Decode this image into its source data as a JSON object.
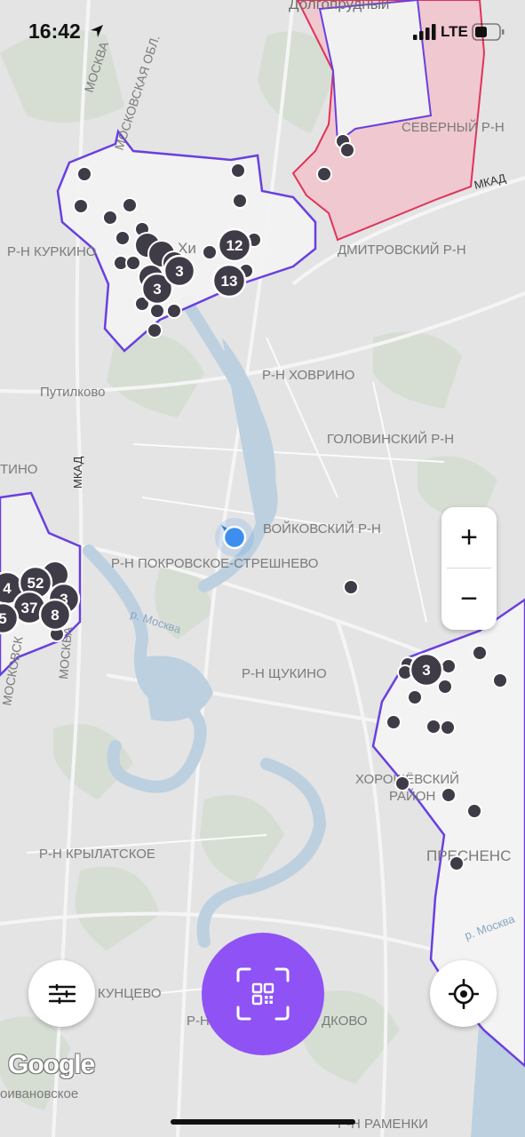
{
  "status_bar": {
    "time": "16:42",
    "network": "LTE"
  },
  "map": {
    "labels": {
      "dolgoprudny": "Долгопрудный",
      "moskva_top": "МОСКВА",
      "moskovskaya_obl": "МОСКОВСКАЯ ОБЛ.",
      "severny": "СЕВЕРНЫЙ Р-Н",
      "mkad_top": "МКАД",
      "kurkino": "Р-Н КУРКИНО",
      "khimki": "Хи",
      "dmitrovsky": "ДМИТРОВСКИЙ Р-Н",
      "putilkovo": "Путилково",
      "khovrino": "Р-Н ХОВРИНО",
      "golovinsky": "ГОЛОВИНСКИЙ Р-Н",
      "tino": "ТИНО",
      "mkad_left": "МКАД",
      "voykovsky": "ВОЙКОВСКИЙ Р-Н",
      "pokrovskoe": "Р-Н ПОКРОВСКОЕ-СТРЕШНЕВО",
      "moskovsk_left": "МОСКОВСК",
      "moskva_left": "МОСКВА",
      "river_left": "р. Москва",
      "shchukino": "Р-Н ЩУКИНО",
      "khoroshevsky_1": "ХОРОШЁВСКИЙ",
      "khoroshevsky_2": "РАЙОН",
      "presnensky": "ПРЕСНЕНС",
      "krylatskoe": "Р-Н КРЫЛАТСКОЕ",
      "river_right": "р. Москва",
      "kuntsevo": "КУНЦЕВО",
      "r_left_frag": "Р-Н",
      "dkovo": "ДКОВО",
      "ivanovskoe": "оивановское",
      "ramenki": "Р-Н РАМЕНКИ"
    },
    "clusters": [
      "3",
      "12",
      "13",
      "3",
      "3",
      "4",
      "52",
      "3",
      "37",
      "5",
      "8",
      "3",
      "3"
    ]
  },
  "controls": {
    "zoom_in": "+",
    "zoom_out": "−"
  },
  "attribution": "Google",
  "colors": {
    "accent": "#8f52f5",
    "zone_border": "#6a3fe0",
    "restricted": "#e0335a",
    "marker": "#3f3c47"
  }
}
